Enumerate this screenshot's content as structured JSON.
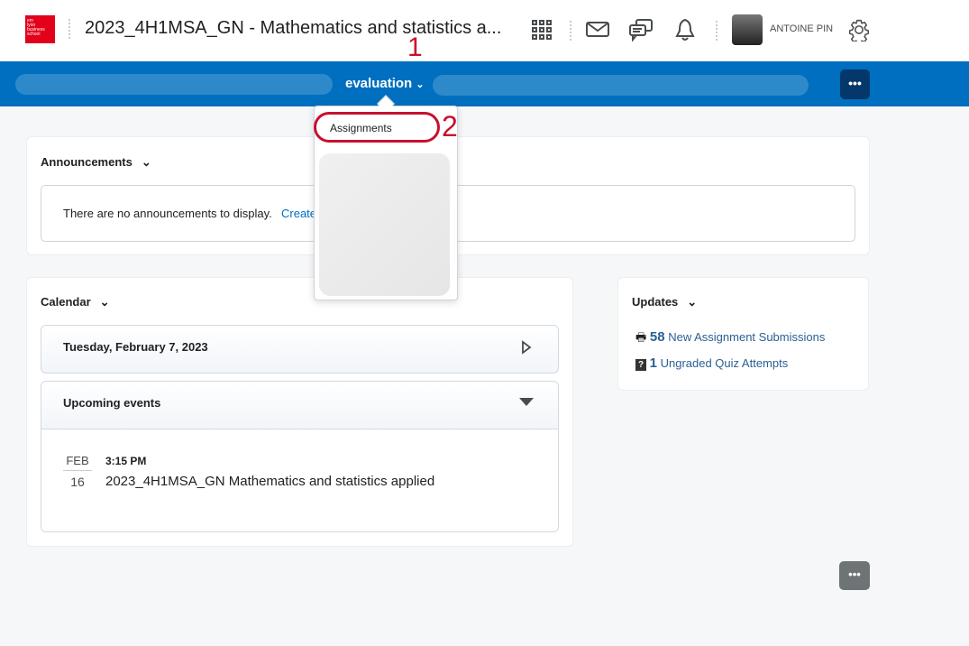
{
  "header": {
    "logo_text": "em lyon business school",
    "course_title": "2023_4H1MSA_GN - Mathematics and statistics a...",
    "user_name": "ANTOINE PIN"
  },
  "nav": {
    "active_label": "evaluation",
    "more_label": "•••"
  },
  "dropdown": {
    "items": [
      {
        "label": "Assignments"
      }
    ]
  },
  "annotations": {
    "step1": "1",
    "step2": "2"
  },
  "announcements": {
    "title": "Announcements",
    "empty_text": "There are no announcements to display.",
    "create_link": "Create"
  },
  "calendar": {
    "title": "Calendar",
    "date": "Tuesday, February 7, 2023",
    "upcoming_title": "Upcoming events",
    "events": [
      {
        "month": "FEB",
        "day": "16",
        "time": "3:15 PM",
        "name": "2023_4H1MSA_GN Mathematics and statistics applied"
      }
    ]
  },
  "updates": {
    "title": "Updates",
    "items": [
      {
        "count": "58",
        "label": "New Assignment Submissions"
      },
      {
        "count": "1",
        "label": "Ungraded Quiz Attempts"
      }
    ]
  },
  "footer": {
    "more_label": "•••"
  }
}
